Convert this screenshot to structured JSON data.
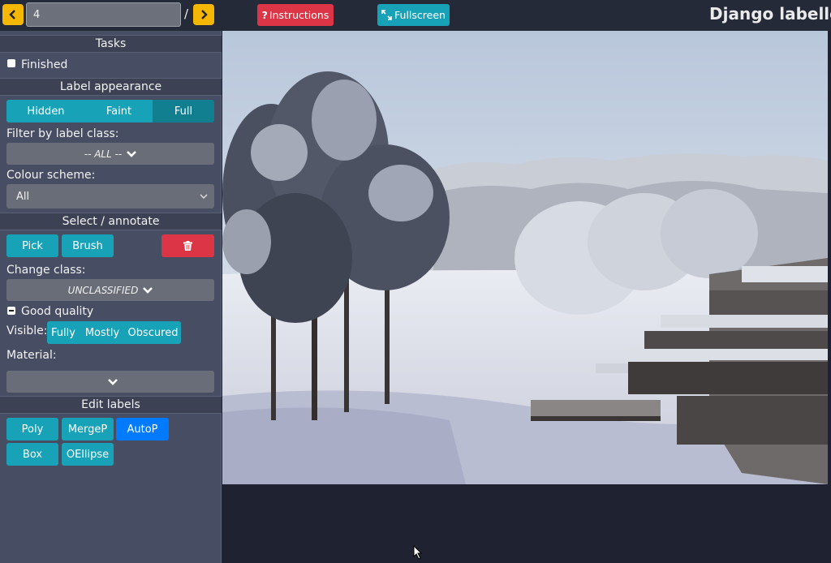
{
  "topbar": {
    "image_number": "4",
    "separator": "/",
    "instructions_label": "Instructions",
    "fullscreen_label": "Fullscreen",
    "app_title": "Django labeller"
  },
  "colors": {
    "warning": "#f5b700",
    "danger": "#dc3545",
    "info": "#17a2b8",
    "primary": "#007bff",
    "sidebar_bg": "#474d63"
  },
  "sidebar": {
    "tasks": {
      "header": "Tasks",
      "finished_label": "Finished",
      "finished_checked": false
    },
    "appearance": {
      "header": "Label appearance",
      "visibility_options": [
        "Hidden",
        "Faint",
        "Full"
      ],
      "visibility_selected": "Full",
      "filter_label": "Filter by label class:",
      "filter_value": "-- ALL --",
      "colour_label": "Colour scheme:",
      "colour_value": "All"
    },
    "annotate": {
      "header": "Select / annotate",
      "pick_label": "Pick",
      "brush_label": "Brush",
      "delete_icon": "trash-icon",
      "change_class_label": "Change class:",
      "class_value": "UNCLASSIFIED",
      "quality_label": "Good quality",
      "visible_label": "Visible:",
      "visible_options": [
        "Fully",
        "Mostly",
        "Obscured"
      ],
      "material_label": "Material:",
      "material_value": ""
    },
    "edit": {
      "header": "Edit labels",
      "tools": [
        "Poly",
        "MergeP",
        "AutoP",
        "Box",
        "OEllipse"
      ],
      "active_tool": "AutoP"
    }
  }
}
